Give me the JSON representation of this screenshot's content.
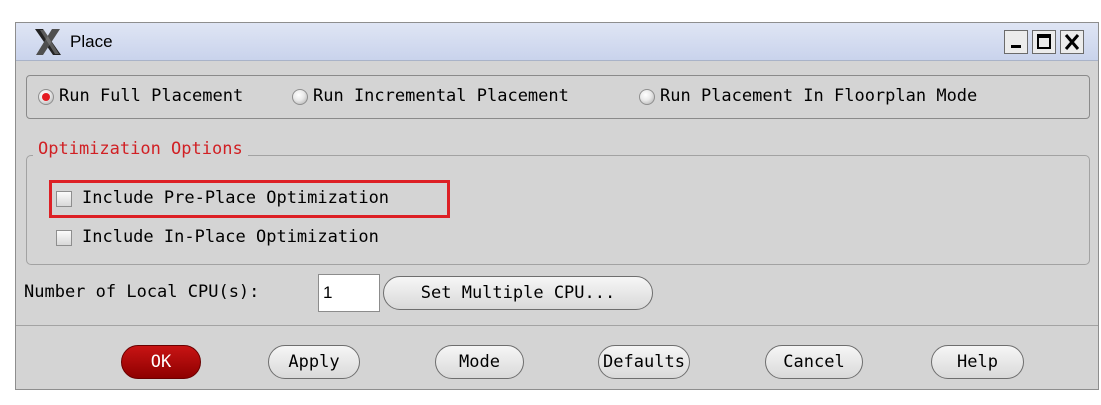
{
  "window": {
    "title": "Place",
    "controls": {
      "minimize": "_",
      "maximize": "□",
      "close": "X"
    }
  },
  "mode": {
    "options": [
      {
        "label": "Run Full Placement",
        "selected": true
      },
      {
        "label": "Run Incremental Placement",
        "selected": false
      },
      {
        "label": "Run Placement In Floorplan Mode",
        "selected": false
      }
    ]
  },
  "optimization": {
    "title": "Optimization Options",
    "options": [
      {
        "label": "Include Pre-Place Optimization",
        "checked": false
      },
      {
        "label": "Include In-Place Optimization",
        "checked": false
      }
    ]
  },
  "cpu": {
    "label": "Number of Local CPU(s):",
    "value": "1",
    "multiple_button": "Set Multiple CPU..."
  },
  "buttons": {
    "ok": "OK",
    "apply": "Apply",
    "mode": "Mode",
    "defaults": "Defaults",
    "cancel": "Cancel",
    "help": "Help"
  },
  "colors": {
    "accent_red": "#e41b22",
    "group_title": "#d12024",
    "highlight": "#dd2025",
    "titlebar": "#d0d9ef"
  },
  "icons": [
    "x-window-logo-icon",
    "minimize-icon",
    "maximize-icon",
    "close-icon"
  ]
}
